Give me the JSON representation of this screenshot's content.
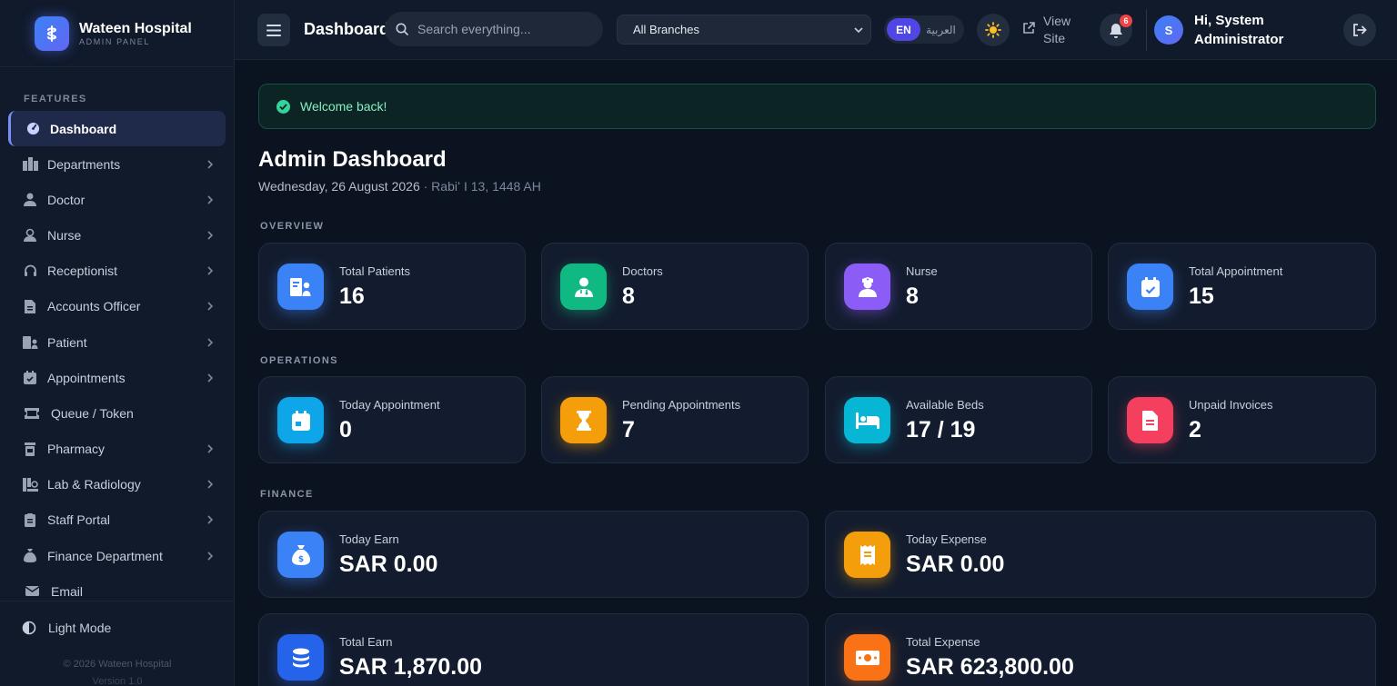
{
  "brand": {
    "name": "Wateen Hospital",
    "subtitle": "ADMIN PANEL"
  },
  "sidebar": {
    "section_label": "FEATURES",
    "items": [
      {
        "label": "Dashboard",
        "icon": "gauge-icon",
        "active": true
      },
      {
        "label": "Departments",
        "icon": "building-icon"
      },
      {
        "label": "Doctor",
        "icon": "doctor-icon"
      },
      {
        "label": "Nurse",
        "icon": "nurse-icon"
      },
      {
        "label": "Receptionist",
        "icon": "headset-icon"
      },
      {
        "label": "Accounts Officer",
        "icon": "file-invoice-icon"
      },
      {
        "label": "Patient",
        "icon": "patient-id-icon"
      },
      {
        "label": "Appointments",
        "icon": "calendar-check-icon"
      },
      {
        "label": "Queue / Token",
        "icon": "ticket-icon"
      },
      {
        "label": "Pharmacy",
        "icon": "prescription-bottle-icon"
      },
      {
        "label": "Lab & Radiology",
        "icon": "microscope-icon"
      },
      {
        "label": "Staff Portal",
        "icon": "clipboard-icon"
      },
      {
        "label": "Finance Department",
        "icon": "money-bag-icon"
      },
      {
        "label": "Email",
        "icon": "envelope-icon"
      }
    ],
    "light_mode_label": "Light Mode",
    "copyright": "© 2026 Wateen Hospital",
    "version": "Version 1.0"
  },
  "topbar": {
    "page_name": "Dashboard",
    "search_placeholder": "Search everything...",
    "branch_selected": "All Branches",
    "lang_en": "EN",
    "lang_ar": "العربية",
    "view_site_line1": "View",
    "view_site_line2": "Site",
    "notification_count": "6",
    "avatar_initial": "S",
    "greeting_line1": "Hi, System",
    "greeting_line2": "Administrator"
  },
  "main": {
    "alert": "Welcome back!",
    "title": "Admin Dashboard",
    "date": "Wednesday, 26 August 2026",
    "hijri": "· Rabiʻ I 13, 1448 AH",
    "groups": {
      "overview": "OVERVIEW",
      "operations": "OPERATIONS",
      "finance": "FINANCE"
    },
    "overview_cards": [
      {
        "label": "Total Patients",
        "value": "16",
        "color": "#3b82f6",
        "icon": "patient-id-icon"
      },
      {
        "label": "Doctors",
        "value": "8",
        "color": "#10b981",
        "icon": "doctor-icon"
      },
      {
        "label": "Nurse",
        "value": "8",
        "color": "#8b5cf6",
        "icon": "nurse-icon"
      },
      {
        "label": "Total Appointment",
        "value": "15",
        "color": "#3b82f6",
        "icon": "calendar-check-icon"
      }
    ],
    "operations_cards": [
      {
        "label": "Today Appointment",
        "value": "0",
        "color": "#0ea5e9",
        "icon": "calendar-day-icon"
      },
      {
        "label": "Pending Appointments",
        "value": "7",
        "color": "#f59e0b",
        "icon": "hourglass-icon"
      },
      {
        "label": "Available Beds",
        "value": "17 / 19",
        "color": "#06b6d4",
        "icon": "bed-icon"
      },
      {
        "label": "Unpaid Invoices",
        "value": "2",
        "color": "#f43f5e",
        "icon": "file-invoice-icon"
      }
    ],
    "finance_cards": [
      {
        "label": "Today Earn",
        "value": "SAR 0.00",
        "color": "#3b82f6",
        "icon": "money-bag-icon"
      },
      {
        "label": "Today Expense",
        "value": "SAR 0.00",
        "color": "#f59e0b",
        "icon": "receipt-icon"
      },
      {
        "label": "Total Earn",
        "value": "SAR 1,870.00",
        "color": "#2563eb",
        "icon": "coins-icon"
      },
      {
        "label": "Total Expense",
        "value": "SAR 623,800.00",
        "color": "#f97316",
        "icon": "money-bill-icon"
      }
    ]
  }
}
